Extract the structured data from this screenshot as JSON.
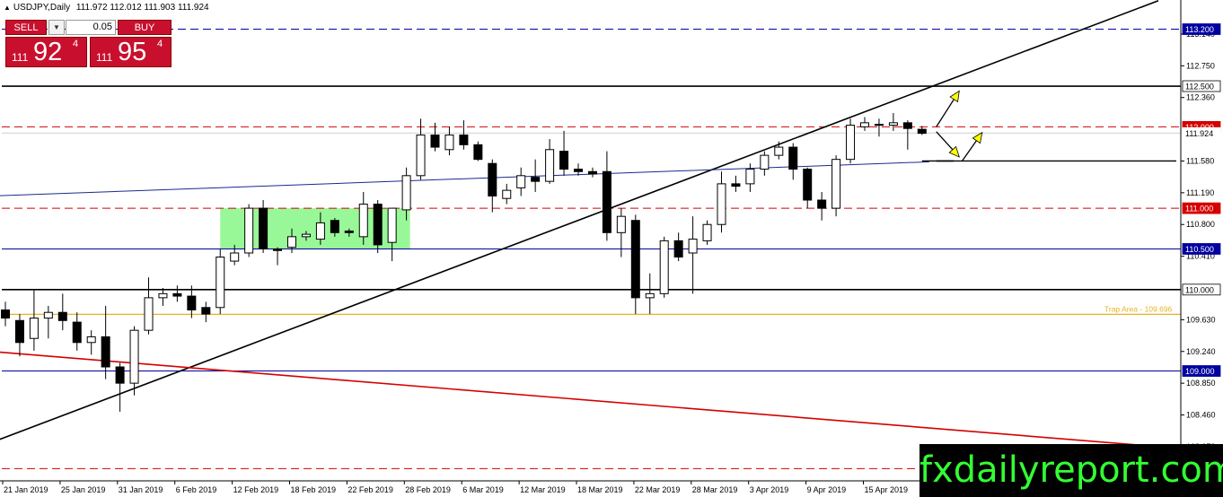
{
  "header": {
    "symbol": "USDJPY,Daily",
    "ohlc": "111.972 112.012 111.903 111.924"
  },
  "trade_panel": {
    "sell_label": "SELL",
    "buy_label": "BUY",
    "lot": "0.05",
    "sell_big": "111",
    "sell_main": "92",
    "sell_sup": "4",
    "buy_big": "111",
    "buy_main": "95",
    "buy_sup": "4"
  },
  "watermark": "fxdailyreport.com",
  "colors": {
    "bull": "#ffffff",
    "bear": "#000000",
    "red_level": "#d40000",
    "blue_level": "#0000a0",
    "trap": "#e6b422",
    "zone": "#98f898",
    "ma": "#1a2a8c",
    "arrow_fill": "#ffff00"
  },
  "chart_data": {
    "type": "candlestick",
    "title": "USDJPY,Daily",
    "ylim": [
      107.65,
      113.36
    ],
    "grid": false,
    "x_ticks": [
      "21 Jan 2019",
      "25 Jan 2019",
      "31 Jan 2019",
      "6 Feb 2019",
      "12 Feb 2019",
      "18 Feb 2019",
      "22 Feb 2019",
      "28 Feb 2019",
      "6 Mar 2019",
      "12 Mar 2019",
      "18 Mar 2019",
      "22 Mar 2019",
      "28 Mar 2019",
      "3 Apr 2019",
      "9 Apr 2019",
      "15 Apr 2019"
    ],
    "y_ticks": [
      "113.140",
      "112.750",
      "112.360",
      "111.580",
      "111.190",
      "110.800",
      "110.410",
      "109.630",
      "109.240",
      "108.850",
      "108.460",
      "108.070",
      "107.680"
    ],
    "levels": [
      {
        "price": 113.2,
        "label": "113.200",
        "style": "dashed",
        "color": "#0000a0"
      },
      {
        "price": 112.5,
        "label": "112.500",
        "style": "solid",
        "color": "#000000"
      },
      {
        "price": 112.0,
        "label": "112.000",
        "style": "dashed",
        "color": "#d40000"
      },
      {
        "price": 111.924,
        "label": "111.924",
        "style": "price",
        "color": "#000000"
      },
      {
        "price": 111.0,
        "label": "111.000",
        "style": "dashed",
        "color": "#d40000"
      },
      {
        "price": 110.5,
        "label": "110.500",
        "style": "solid",
        "color": "#0000a0"
      },
      {
        "price": 110.0,
        "label": "110.000",
        "style": "solid",
        "color": "#000000"
      },
      {
        "price": 109.0,
        "label": "109.000",
        "style": "solid",
        "color": "#0000a0"
      },
      {
        "price": 107.8,
        "label": "",
        "style": "dashed",
        "color": "#d40000"
      }
    ],
    "trap_area": {
      "price": 109.696,
      "label": "Trap Area - 109.696"
    },
    "candles": [
      {
        "o": 109.75,
        "h": 109.85,
        "l": 109.55,
        "c": 109.65
      },
      {
        "o": 109.62,
        "h": 109.7,
        "l": 109.18,
        "c": 109.35
      },
      {
        "o": 109.4,
        "h": 110.0,
        "l": 109.25,
        "c": 109.65
      },
      {
        "o": 109.65,
        "h": 109.8,
        "l": 109.4,
        "c": 109.72
      },
      {
        "o": 109.72,
        "h": 109.95,
        "l": 109.5,
        "c": 109.62
      },
      {
        "o": 109.6,
        "h": 109.72,
        "l": 109.25,
        "c": 109.35
      },
      {
        "o": 109.35,
        "h": 109.5,
        "l": 109.2,
        "c": 109.42
      },
      {
        "o": 109.42,
        "h": 109.8,
        "l": 108.9,
        "c": 109.05
      },
      {
        "o": 109.05,
        "h": 109.1,
        "l": 108.5,
        "c": 108.85
      },
      {
        "o": 108.85,
        "h": 109.55,
        "l": 108.7,
        "c": 109.5
      },
      {
        "o": 109.5,
        "h": 110.15,
        "l": 109.45,
        "c": 109.9
      },
      {
        "o": 109.9,
        "h": 110.02,
        "l": 109.8,
        "c": 109.95
      },
      {
        "o": 109.95,
        "h": 110.05,
        "l": 109.85,
        "c": 109.92
      },
      {
        "o": 109.92,
        "h": 110.05,
        "l": 109.65,
        "c": 109.75
      },
      {
        "o": 109.78,
        "h": 109.85,
        "l": 109.6,
        "c": 109.7
      },
      {
        "o": 109.78,
        "h": 110.5,
        "l": 109.7,
        "c": 110.4
      },
      {
        "o": 110.35,
        "h": 110.55,
        "l": 110.3,
        "c": 110.45
      },
      {
        "o": 110.45,
        "h": 111.05,
        "l": 110.4,
        "c": 111.0
      },
      {
        "o": 111.0,
        "h": 111.1,
        "l": 110.45,
        "c": 110.5
      },
      {
        "o": 110.5,
        "h": 110.52,
        "l": 110.3,
        "c": 110.48
      },
      {
        "o": 110.52,
        "h": 110.75,
        "l": 110.45,
        "c": 110.65
      },
      {
        "o": 110.65,
        "h": 110.72,
        "l": 110.6,
        "c": 110.68
      },
      {
        "o": 110.62,
        "h": 110.95,
        "l": 110.55,
        "c": 110.82
      },
      {
        "o": 110.85,
        "h": 110.88,
        "l": 110.65,
        "c": 110.7
      },
      {
        "o": 110.72,
        "h": 110.75,
        "l": 110.65,
        "c": 110.7
      },
      {
        "o": 110.65,
        "h": 111.2,
        "l": 110.55,
        "c": 111.05
      },
      {
        "o": 111.05,
        "h": 111.1,
        "l": 110.45,
        "c": 110.55
      },
      {
        "o": 110.58,
        "h": 111.0,
        "l": 110.35,
        "c": 111.0
      },
      {
        "o": 110.98,
        "h": 111.5,
        "l": 110.85,
        "c": 111.4
      },
      {
        "o": 111.4,
        "h": 112.1,
        "l": 111.35,
        "c": 111.9
      },
      {
        "o": 111.9,
        "h": 112.05,
        "l": 111.7,
        "c": 111.75
      },
      {
        "o": 111.72,
        "h": 112.0,
        "l": 111.65,
        "c": 111.9
      },
      {
        "o": 111.9,
        "h": 112.08,
        "l": 111.72,
        "c": 111.78
      },
      {
        "o": 111.78,
        "h": 111.82,
        "l": 111.58,
        "c": 111.6
      },
      {
        "o": 111.55,
        "h": 111.6,
        "l": 110.95,
        "c": 111.15
      },
      {
        "o": 111.12,
        "h": 111.3,
        "l": 111.05,
        "c": 111.22
      },
      {
        "o": 111.25,
        "h": 111.5,
        "l": 111.15,
        "c": 111.4
      },
      {
        "o": 111.38,
        "h": 111.6,
        "l": 111.2,
        "c": 111.33
      },
      {
        "o": 111.33,
        "h": 111.85,
        "l": 111.3,
        "c": 111.72
      },
      {
        "o": 111.7,
        "h": 111.95,
        "l": 111.4,
        "c": 111.48
      },
      {
        "o": 111.48,
        "h": 111.55,
        "l": 111.4,
        "c": 111.45
      },
      {
        "o": 111.45,
        "h": 111.5,
        "l": 111.38,
        "c": 111.42
      },
      {
        "o": 111.45,
        "h": 111.7,
        "l": 110.6,
        "c": 110.7
      },
      {
        "o": 110.7,
        "h": 111.0,
        "l": 110.4,
        "c": 110.9
      },
      {
        "o": 110.85,
        "h": 110.92,
        "l": 109.7,
        "c": 109.9
      },
      {
        "o": 109.9,
        "h": 110.2,
        "l": 109.7,
        "c": 109.95
      },
      {
        "o": 109.95,
        "h": 110.65,
        "l": 109.9,
        "c": 110.6
      },
      {
        "o": 110.6,
        "h": 110.7,
        "l": 110.35,
        "c": 110.4
      },
      {
        "o": 110.45,
        "h": 110.9,
        "l": 109.95,
        "c": 110.62
      },
      {
        "o": 110.6,
        "h": 110.85,
        "l": 110.55,
        "c": 110.8
      },
      {
        "o": 110.8,
        "h": 111.45,
        "l": 110.7,
        "c": 111.3
      },
      {
        "o": 111.3,
        "h": 111.4,
        "l": 111.2,
        "c": 111.27
      },
      {
        "o": 111.3,
        "h": 111.55,
        "l": 111.2,
        "c": 111.48
      },
      {
        "o": 111.48,
        "h": 111.7,
        "l": 111.4,
        "c": 111.65
      },
      {
        "o": 111.65,
        "h": 111.82,
        "l": 111.6,
        "c": 111.75
      },
      {
        "o": 111.75,
        "h": 111.8,
        "l": 111.35,
        "c": 111.48
      },
      {
        "o": 111.48,
        "h": 111.5,
        "l": 111.0,
        "c": 111.1
      },
      {
        "o": 111.1,
        "h": 111.2,
        "l": 110.85,
        "c": 111.0
      },
      {
        "o": 111.0,
        "h": 111.65,
        "l": 110.9,
        "c": 111.6
      },
      {
        "o": 111.6,
        "h": 112.1,
        "l": 111.55,
        "c": 112.02
      },
      {
        "o": 112.0,
        "h": 112.12,
        "l": 111.95,
        "c": 112.05
      },
      {
        "o": 112.03,
        "h": 112.1,
        "l": 111.88,
        "c": 112.02
      },
      {
        "o": 112.02,
        "h": 112.17,
        "l": 111.95,
        "c": 112.05
      },
      {
        "o": 112.05,
        "h": 112.08,
        "l": 111.72,
        "c": 111.98
      },
      {
        "o": 111.97,
        "h": 112.01,
        "l": 111.9,
        "c": 111.92
      }
    ],
    "trendlines": [
      {
        "name": "",
        "color": "#000000",
        "from": [
          -1,
          108.12
        ],
        "to": [
          80.5,
          113.55
        ]
      },
      {
        "name": "",
        "color": "#d40000",
        "from": [
          -1,
          109.24
        ],
        "to": [
          80.5,
          108.07
        ]
      },
      {
        "name": "",
        "color": "#1a2a8c",
        "from": [
          -1,
          111.15
        ],
        "to": [
          64.5,
          111.57
        ]
      }
    ]
  }
}
